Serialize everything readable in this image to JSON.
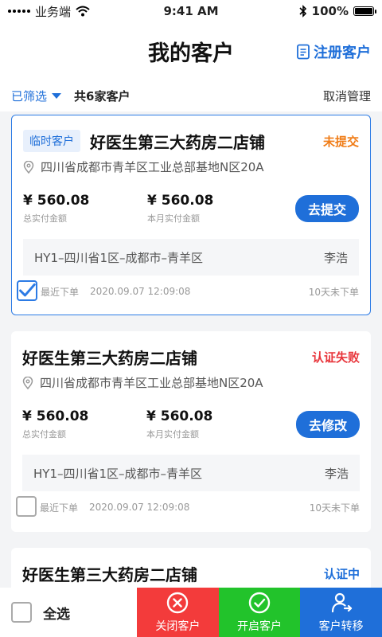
{
  "status_bar": {
    "carrier": "业务端",
    "time": "9:41 AM",
    "battery": "100%"
  },
  "nav": {
    "title": "我的客户",
    "register_label": "注册客户"
  },
  "filter": {
    "filter_label": "已筛选",
    "count_text": "共6家客户",
    "manage_label": "取消管理"
  },
  "colors": {
    "primary": "#1f6fd9",
    "orange": "#f07d18",
    "red": "#e8353b",
    "green": "#22c32b",
    "close_red": "#f33b3b"
  },
  "cards": [
    {
      "tag": "临时客户",
      "name": "好医生第三大药房二店铺",
      "status": "未提交",
      "address": "四川省成都市青羊区工业总部基地N区20A",
      "total_amount": "¥ 560.08",
      "total_label": "总实付金额",
      "month_amount": "¥ 560.08",
      "month_label": "本月实付金额",
      "action": "去提交",
      "region": "HY1–四川省1区–成都市–青羊区",
      "person": "李浩",
      "recent_label": "最近下单",
      "recent_time": "2020.09.07   12:09:08",
      "days": "10天未下单",
      "checked": true
    },
    {
      "name": "好医生第三大药房二店铺",
      "status": "认证失败",
      "address": "四川省成都市青羊区工业总部基地N区20A",
      "total_amount": "¥ 560.08",
      "total_label": "总实付金额",
      "month_amount": "¥ 560.08",
      "month_label": "本月实付金额",
      "action": "去修改",
      "region": "HY1–四川省1区–成都市–青羊区",
      "person": "李浩",
      "recent_label": "最近下单",
      "recent_time": "2020.09.07   12:09:08",
      "days": "10天未下单",
      "checked": false
    },
    {
      "name": "好医生第三大药房二店铺",
      "status": "认证中"
    }
  ],
  "bottom": {
    "select_all": "全选",
    "close": "关闭客户",
    "open": "开启客户",
    "transfer": "客户转移"
  }
}
